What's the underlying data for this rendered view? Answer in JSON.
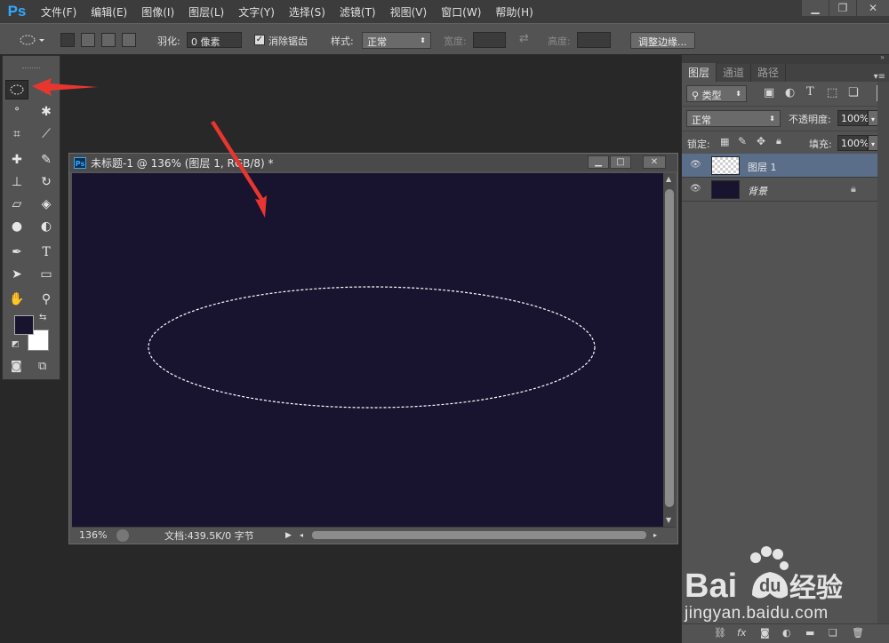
{
  "app": {
    "logo": "Ps"
  },
  "menu": [
    "文件(F)",
    "编辑(E)",
    "图像(I)",
    "图层(L)",
    "文字(Y)",
    "选择(S)",
    "滤镜(T)",
    "视图(V)",
    "窗口(W)",
    "帮助(H)"
  ],
  "window_controls": {
    "minimize": "▁",
    "restore": "❐",
    "close": "✕"
  },
  "options": {
    "feather_label": "羽化:",
    "feather_value": "0 像素",
    "antialias_label": "消除锯齿",
    "antialias_checked": true,
    "style_label": "样式:",
    "style_value": "正常",
    "width_label": "宽度:",
    "height_label": "高度:",
    "refine_edge_button": "调整边缘..."
  },
  "tools": [
    {
      "name": "elliptical-marquee",
      "glyph": "◯",
      "active": true
    },
    {
      "name": "move",
      "glyph": "✥"
    },
    {
      "name": "lasso",
      "glyph": "ᐤ"
    },
    {
      "name": "magic-wand",
      "glyph": "✱"
    },
    {
      "name": "crop",
      "glyph": "⌗"
    },
    {
      "name": "eyedropper",
      "glyph": "⟋"
    },
    {
      "name": "healing",
      "glyph": "✚"
    },
    {
      "name": "brush",
      "glyph": "✎"
    },
    {
      "name": "stamp",
      "glyph": "⊥"
    },
    {
      "name": "history-brush",
      "glyph": "↻"
    },
    {
      "name": "eraser",
      "glyph": "▱"
    },
    {
      "name": "paint-bucket",
      "glyph": "◈"
    },
    {
      "name": "blur",
      "glyph": "●"
    },
    {
      "name": "dodge",
      "glyph": "◐"
    },
    {
      "name": "pen",
      "glyph": "✒"
    },
    {
      "name": "type",
      "glyph": "T"
    },
    {
      "name": "path-select",
      "glyph": "➤"
    },
    {
      "name": "rectangle",
      "glyph": "▭"
    },
    {
      "name": "hand",
      "glyph": "✋"
    },
    {
      "name": "zoom",
      "glyph": "⚲"
    }
  ],
  "colors": {
    "foreground": "#181430",
    "background": "#ffffff",
    "accent": "#31a8ff"
  },
  "document": {
    "title": "未标题-1 @ 136% (图层 1, RGB/8) *",
    "zoom": "136%",
    "doc_info": "文档:439.5K/0 字节",
    "canvas_color": "#181430"
  },
  "layers_panel": {
    "tabs": [
      "图层",
      "通道",
      "路径"
    ],
    "filter_value": "类型",
    "blend_mode": "正常",
    "opacity_label": "不透明度:",
    "opacity_value": "100%",
    "lock_label": "锁定:",
    "fill_label": "填充:",
    "fill_value": "100%",
    "layers": [
      {
        "name": "图层 1",
        "selected": true,
        "thumbnail": "transparent"
      },
      {
        "name": "背景",
        "selected": false,
        "thumbnail": "#181430",
        "locked": true
      }
    ]
  },
  "watermark": {
    "url": "jingyan.baidu.com"
  }
}
